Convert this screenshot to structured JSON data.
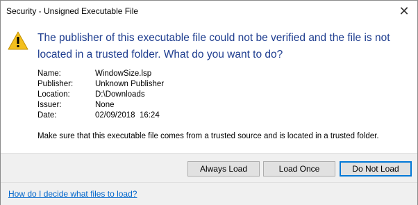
{
  "window": {
    "title": "Security - Unsigned Executable File",
    "close_glyph": "✕"
  },
  "icons": {
    "warning": "warning-icon",
    "close": "close-icon"
  },
  "colors": {
    "headline": "#1e3d8f",
    "link": "#0066cc",
    "warning_fill": "#f4c01e",
    "default_button_border": "#0078d7"
  },
  "message": {
    "headline": "The publisher of this executable file could not be verified and the file is not located in a trusted folder. What do you want to do?",
    "note": "Make sure that this executable file comes from a trusted source and is located in a trusted folder."
  },
  "details": [
    {
      "label": "Name:",
      "value": "WindowSize.lsp"
    },
    {
      "label": "Publisher:",
      "value": "Unknown Publisher"
    },
    {
      "label": "Location:",
      "value": "D:\\Downloads"
    },
    {
      "label": "Issuer:",
      "value": "None"
    },
    {
      "label": "Date:",
      "value": "02/09/2018  16:24"
    }
  ],
  "buttons": {
    "always_load": "Always Load",
    "load_once": "Load Once",
    "do_not_load": "Do Not Load"
  },
  "footer": {
    "help_link": "How do I decide what files to load?"
  }
}
